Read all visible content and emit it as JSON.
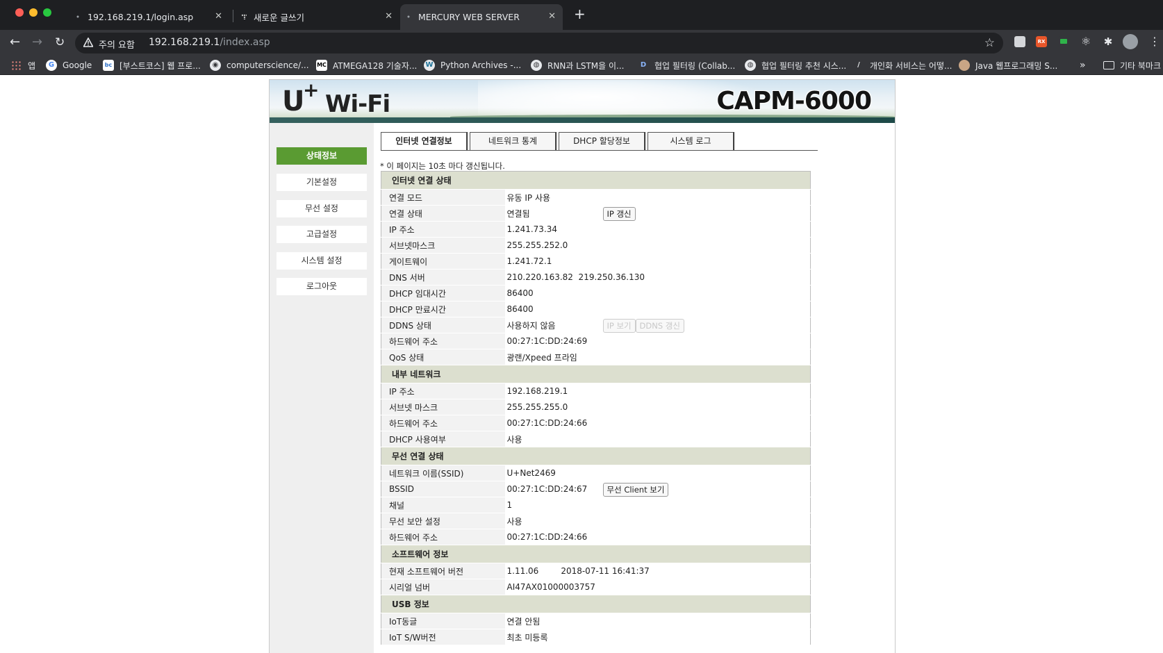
{
  "browser": {
    "tabs": [
      {
        "title": "192.168.219.1/login.asp",
        "active": false
      },
      {
        "title": "새로운 글쓰기",
        "active": false
      },
      {
        "title": "MERCURY WEB SERVER",
        "active": true
      }
    ],
    "address": {
      "security_label": "주의 요함",
      "host": "192.168.219.1",
      "path": "/index.asp"
    },
    "bookmarks": [
      {
        "label": "앱",
        "icon": "apps-grid-icon"
      },
      {
        "label": "Google",
        "icon": "google-icon"
      },
      {
        "label": "[부스트코스] 웹 프로...",
        "icon": "boostcourse-icon"
      },
      {
        "label": "computerscience/...",
        "icon": "github-icon"
      },
      {
        "label": "ATMEGA128 기술자...",
        "icon": "mc-icon"
      },
      {
        "label": "Python Archives -...",
        "icon": "wordpress-icon"
      },
      {
        "label": "RNN과 LSTM을 이...",
        "icon": "globe-icon"
      },
      {
        "label": "협업 필터링 (Collab...",
        "icon": "d-icon"
      },
      {
        "label": "협업 필터링 추천 시스...",
        "icon": "globe-icon"
      },
      {
        "label": "개인화 서비스는 어떻...",
        "icon": "slash-icon"
      },
      {
        "label": "Java 웹프로그래밍 S...",
        "icon": "avatar-icon"
      }
    ],
    "bookmarks_more": "»",
    "other_bookmarks": "기타 북마크",
    "colors": {
      "tabbar": "#1e1f22",
      "toolbar": "#35363a"
    }
  },
  "page": {
    "brand_logo": "U+ Wi-Fi",
    "model": "CAPM-6000",
    "sidebar": [
      {
        "label": "상태정보",
        "active": true
      },
      {
        "label": "기본설정",
        "active": false
      },
      {
        "label": "무선 설정",
        "active": false
      },
      {
        "label": "고급설정",
        "active": false
      },
      {
        "label": "시스템 설정",
        "active": false
      },
      {
        "label": "로그아웃",
        "active": false
      }
    ],
    "tabs": [
      {
        "label": "인터넷 연결정보",
        "active": true
      },
      {
        "label": "네트워크 통계",
        "active": false
      },
      {
        "label": "DHCP 할당정보",
        "active": false
      },
      {
        "label": "시스템 로그",
        "active": false
      }
    ],
    "refresh_note": "* 이 페이지는 10초 마다 갱신됩니다.",
    "sections": [
      {
        "title": "인터넷 연결 상태",
        "rows": [
          {
            "label": "연결 모드",
            "value": "유동 IP 사용"
          },
          {
            "label": "연결 상태",
            "value": "연결됨",
            "buttons": [
              {
                "label": "IP 갱신",
                "disabled": false
              }
            ]
          },
          {
            "label": "IP 주소",
            "value": "1.241.73.34"
          },
          {
            "label": "서브넷마스크",
            "value": "255.255.252.0"
          },
          {
            "label": "게이트웨이",
            "value": "1.241.72.1"
          },
          {
            "label": "DNS 서버",
            "value": "210.220.163.82  219.250.36.130"
          },
          {
            "label": "DHCP 임대시간",
            "value": "86400"
          },
          {
            "label": "DHCP 만료시간",
            "value": "86400"
          },
          {
            "label": "DDNS 상태",
            "value": "사용하지 않음",
            "buttons": [
              {
                "label": "IP 보기",
                "disabled": true
              },
              {
                "label": "DDNS 갱신",
                "disabled": true
              }
            ]
          },
          {
            "label": "하드웨어 주소",
            "value": "00:27:1C:DD:24:69"
          },
          {
            "label": "QoS 상태",
            "value": "광랜/Xpeed 프라임"
          }
        ]
      },
      {
        "title": "내부 네트워크",
        "rows": [
          {
            "label": "IP 주소",
            "value": "192.168.219.1"
          },
          {
            "label": "서브넷 마스크",
            "value": "255.255.255.0"
          },
          {
            "label": "하드웨어 주소",
            "value": "00:27:1C:DD:24:66"
          },
          {
            "label": "DHCP 사용여부",
            "value": "사용"
          }
        ]
      },
      {
        "title": "무선 연결 상태",
        "rows": [
          {
            "label": "네트워크 이름(SSID)",
            "value": "U+Net2469"
          },
          {
            "label": "BSSID",
            "value": "00:27:1C:DD:24:67",
            "buttons": [
              {
                "label": "무선 Client 보기",
                "disabled": false
              }
            ]
          },
          {
            "label": "채널",
            "value": "1"
          },
          {
            "label": "무선 보안 설정",
            "value": "사용"
          },
          {
            "label": "하드웨어 주소",
            "value": "00:27:1C:DD:24:66"
          }
        ]
      },
      {
        "title": "소프트웨어 정보",
        "rows": [
          {
            "label": "현재 소프트웨어 버전",
            "value": "1.11.06",
            "value2": "2018-07-11 16:41:37"
          },
          {
            "label": "시리얼 넘버",
            "value": "AI47AX01000003757"
          }
        ]
      },
      {
        "title": "USB 정보",
        "rows": [
          {
            "label": "IoT동글",
            "value": "연결 안됨"
          },
          {
            "label": "IoT S/W버전",
            "value": "최초 미등록"
          }
        ]
      }
    ],
    "colors": {
      "menu_active": "#5a9b32",
      "section_bg": "#dcdfcf",
      "label_bg": "#f2f2f2"
    }
  }
}
